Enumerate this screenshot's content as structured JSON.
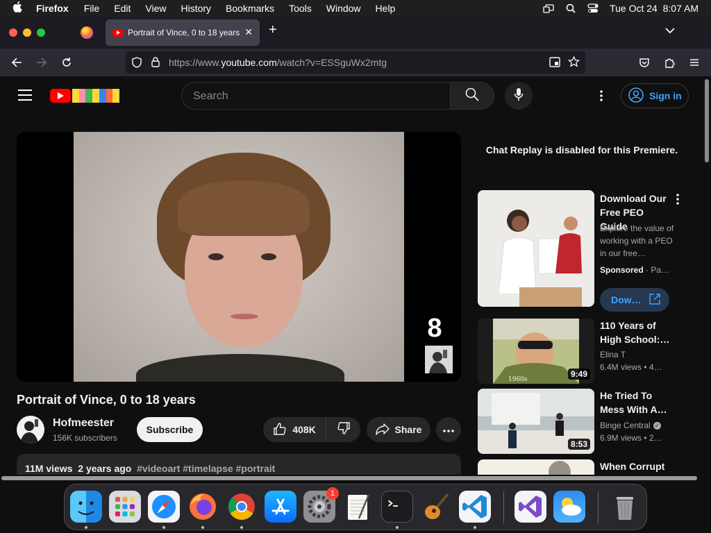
{
  "menubar": {
    "app_name": "Firefox",
    "menus": [
      "File",
      "Edit",
      "View",
      "History",
      "Bookmarks",
      "Tools",
      "Window",
      "Help"
    ],
    "datetime": "Tue Oct 24  8:07 AM"
  },
  "browser": {
    "tab_title": "Portrait of Vince, 0 to 18 years",
    "url_prefix": "https://www.",
    "url_host": "youtube.com",
    "url_path": "/watch?v=ESSguWx2mtg"
  },
  "youtube": {
    "search_placeholder": "Search",
    "sign_in_label": "Sign in",
    "accent_color": "#3ea6ff"
  },
  "video": {
    "title": "Portrait of Vince, 0 to 18 years",
    "overlay_age": "8",
    "channel_name": "Hofmeester",
    "subscribers": "156K subscribers",
    "subscribe_label": "Subscribe",
    "likes": "408K",
    "share_label": "Share",
    "views": "11M views",
    "posted": "2 years ago",
    "tags": "#videoart #timelapse #portrait"
  },
  "sidebar": {
    "chat_notice": "Chat Replay is disabled for this Premiere.",
    "ad": {
      "title": "Download Our Free PEO Guide",
      "description": "Explore the value of working with a PEO in our free…",
      "sponsored": "Sponsored",
      "advertiser": "Pa…",
      "cta": "Dow…"
    },
    "recommendations": [
      {
        "title": "110 Years of High School:…",
        "channel": "Elina T",
        "views": "6.4M views",
        "age": "4…",
        "duration": "9:49",
        "thumb_caption": "1960s"
      },
      {
        "title": "He Tried To Mess With A…",
        "channel": "Binge Central",
        "views": "6.9M views",
        "age": "2…",
        "duration": "8:53"
      },
      {
        "title": "When Corrupt"
      }
    ]
  },
  "dock": {
    "apps": [
      {
        "name": "Finder",
        "icon": "finder-icon"
      },
      {
        "name": "Launchpad",
        "icon": "launchpad-icon"
      },
      {
        "name": "Safari",
        "icon": "safari-icon"
      },
      {
        "name": "Firefox",
        "icon": "firefox-icon"
      },
      {
        "name": "Chrome",
        "icon": "chrome-icon"
      },
      {
        "name": "App Store",
        "icon": "app-store-icon"
      },
      {
        "name": "System Settings",
        "icon": "settings-icon",
        "badge": "1"
      },
      {
        "name": "TextEdit",
        "icon": "textedit-icon"
      },
      {
        "name": "Terminal",
        "icon": "terminal-icon"
      },
      {
        "name": "GarageBand",
        "icon": "guitar-icon"
      },
      {
        "name": "Visual Studio Code",
        "icon": "vscode-icon"
      },
      {
        "name": "Visual Studio",
        "icon": "visual-studio-icon"
      },
      {
        "name": "Weather",
        "icon": "weather-icon"
      },
      {
        "name": "Trash",
        "icon": "trash-icon"
      }
    ]
  }
}
